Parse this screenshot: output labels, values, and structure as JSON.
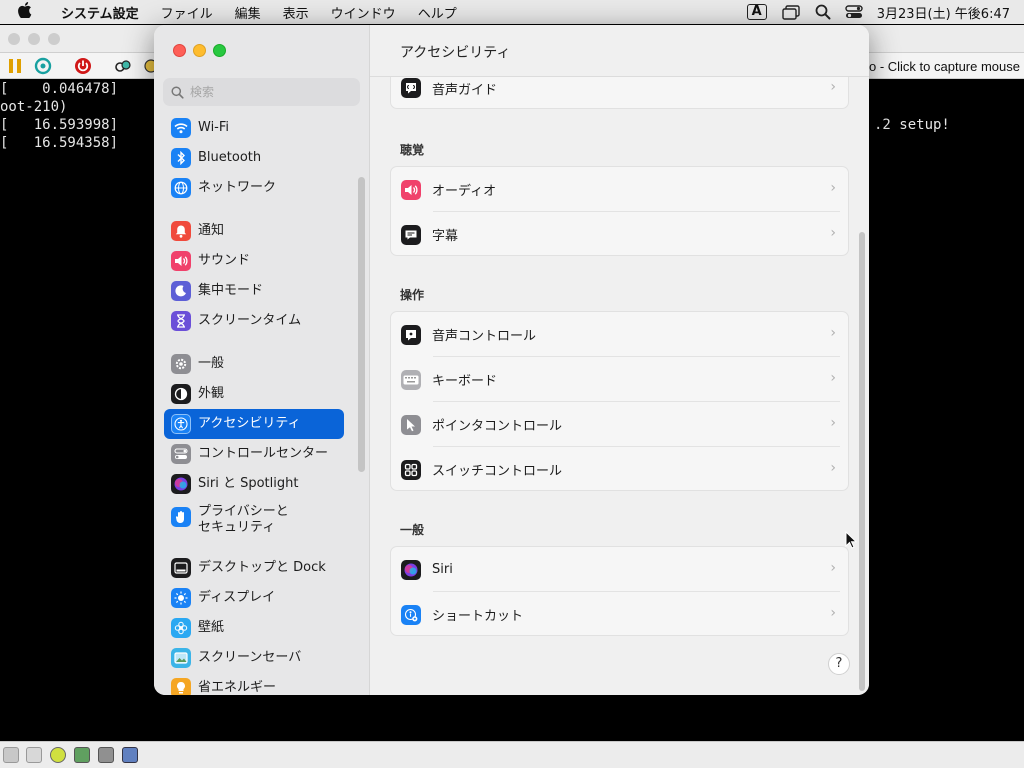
{
  "menubar": {
    "app": "システム設定",
    "items": [
      "ファイル",
      "編集",
      "表示",
      "ウインドウ",
      "ヘルプ"
    ],
    "input_indicator": "A",
    "datetime": "3月23日(土) 午後6:47"
  },
  "vm": {
    "hint": "o - Click to capture mouse",
    "console_lines": [
      "[    0.046478]",
      "oot-210)",
      "[   16.593998]",
      "[   16.594358]"
    ],
    "console_right": ".2 setup!"
  },
  "settings": {
    "search_placeholder": "検索",
    "sidebar": {
      "items": [
        {
          "label": "Wi-Fi",
          "icon": "wifi-icon",
          "color": "#1a82f5"
        },
        {
          "label": "Bluetooth",
          "icon": "bluetooth-icon",
          "color": "#1a82f5"
        },
        {
          "label": "ネットワーク",
          "icon": "globe-icon",
          "color": "#1a82f5"
        },
        {
          "label": "通知",
          "icon": "bell-icon",
          "color": "#f04a3c"
        },
        {
          "label": "サウンド",
          "icon": "speaker-icon",
          "color": "#f0416b"
        },
        {
          "label": "集中モード",
          "icon": "moon-icon",
          "color": "#5d5fd6"
        },
        {
          "label": "スクリーンタイム",
          "icon": "hourglass-icon",
          "color": "#6b4fd8"
        },
        {
          "label": "一般",
          "icon": "gear-icon",
          "color": "#8e8e93"
        },
        {
          "label": "外観",
          "icon": "appearance-icon",
          "color": "#1c1c1e"
        },
        {
          "label": "アクセシビリティ",
          "icon": "accessibility-icon",
          "color": "#1a82f5"
        },
        {
          "label": "コントロールセンター",
          "icon": "toggles-icon",
          "color": "#8e8e93"
        },
        {
          "label": "Siri と Spotlight",
          "icon": "siri-icon",
          "color": "#7b3fe4"
        },
        {
          "label": "プライバシーと",
          "label2": "セキュリティ",
          "icon": "hand-icon",
          "color": "#1a82f5"
        },
        {
          "label": "デスクトップと Dock",
          "icon": "dock-icon",
          "color": "#1c1c1e"
        },
        {
          "label": "ディスプレイ",
          "icon": "sun-icon",
          "color": "#1a82f5"
        },
        {
          "label": "壁紙",
          "icon": "flower-icon",
          "color": "#2aa8f2"
        },
        {
          "label": "スクリーンセーバ",
          "icon": "screensaver-icon",
          "color": "#3cb4e8"
        },
        {
          "label": "省エネルギー",
          "icon": "bulb-icon",
          "color": "#f5a623"
        }
      ]
    },
    "content": {
      "title": "アクセシビリティ",
      "top_row": {
        "label": "音声ガイド",
        "icon": "voiceover-icon"
      },
      "sections": [
        {
          "title": "聴覚",
          "rows": [
            {
              "label": "オーディオ",
              "icon": "audio-icon",
              "color": "#f0416b"
            },
            {
              "label": "字幕",
              "icon": "captions-icon",
              "color": "#1c1c1e"
            }
          ]
        },
        {
          "title": "操作",
          "rows": [
            {
              "label": "音声コントロール",
              "icon": "voice-control-icon",
              "color": "#1c1c1e"
            },
            {
              "label": "キーボード",
              "icon": "keyboard-icon",
              "color": "#b0b0b4"
            },
            {
              "label": "ポインタコントロール",
              "icon": "pointer-icon",
              "color": "#8e8e93"
            },
            {
              "label": "スイッチコントロール",
              "icon": "switch-control-icon",
              "color": "#1c1c1e"
            }
          ]
        },
        {
          "title": "一般",
          "rows": [
            {
              "label": "Siri",
              "icon": "siri-icon",
              "color": "#7b3fe4"
            },
            {
              "label": "ショートカット",
              "icon": "shortcut-icon",
              "color": "#1a82f5"
            }
          ]
        }
      ],
      "help": "?"
    }
  }
}
